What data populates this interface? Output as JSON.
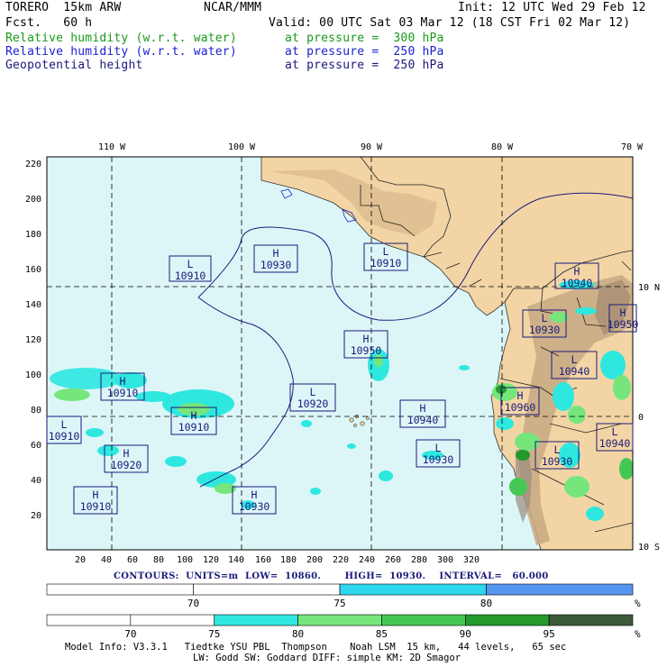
{
  "header": {
    "model": "TORERO  15km ARW",
    "center": "NCAR/MMM",
    "init": "Init: 12 UTC Wed 29 Feb 12",
    "fcst": "Fcst.   60 h",
    "valid": "Valid: 00 UTC Sat 03 Mar 12 (18 CST Fri 02 Mar 12)",
    "fields": [
      {
        "name": "Relative humidity (w.r.t. water)",
        "level": "at pressure =  300 hPa",
        "color": "#1a9a1a"
      },
      {
        "name": "Relative humidity (w.r.t. water)",
        "level": "at pressure =  250 hPa",
        "color": "#1a22cc"
      },
      {
        "name": "Geopotential height",
        "level": "at pressure =  250 hPa",
        "color": "#1a1a7a"
      }
    ]
  },
  "map": {
    "top_lon_labels": [
      "110 W",
      "100 W",
      "90 W",
      "80 W",
      "70 W"
    ],
    "right_lat_labels": [
      "10 N",
      "0",
      "10 S"
    ],
    "y_ticks": [
      "220",
      "200",
      "180",
      "160",
      "140",
      "120",
      "100",
      "80",
      "60",
      "40",
      "20"
    ],
    "x_ticks": [
      "20",
      "40",
      "60",
      "80",
      "100",
      "120",
      "140",
      "160",
      "180",
      "200",
      "220",
      "240",
      "260",
      "280",
      "300",
      "320"
    ],
    "highs_lows": [
      {
        "kind": "L",
        "value": "10910"
      },
      {
        "kind": "H",
        "value": "10930"
      },
      {
        "kind": "L",
        "value": "10910"
      },
      {
        "kind": "H",
        "value": "10940"
      },
      {
        "kind": "L",
        "value": "10930"
      },
      {
        "kind": "H",
        "value": "10950"
      },
      {
        "kind": "H",
        "value": "10950"
      },
      {
        "kind": "L",
        "value": "10940"
      },
      {
        "kind": "H",
        "value": "10910"
      },
      {
        "kind": "L",
        "value": "10920"
      },
      {
        "kind": "H",
        "value": "10960"
      },
      {
        "kind": "H",
        "value": "10910"
      },
      {
        "kind": "H",
        "value": "10940"
      },
      {
        "kind": "L",
        "value": "10910"
      },
      {
        "kind": "L",
        "value": "10940"
      },
      {
        "kind": "H",
        "value": "10920"
      },
      {
        "kind": "L",
        "value": "10930"
      },
      {
        "kind": "L",
        "value": "10930"
      },
      {
        "kind": "H",
        "value": "10910"
      },
      {
        "kind": "H",
        "value": "10930"
      }
    ]
  },
  "contours": {
    "text": "CONTOURS:  UNITS=m  LOW=  10860.       HIGH=  10930.    INTERVAL=   60.000"
  },
  "colorbar_300": {
    "ticks": [
      "70",
      "75",
      "80"
    ],
    "unit": "%",
    "colors": [
      "#ffffff",
      "#ffffff",
      "#2ed6ee",
      "#5596f0"
    ]
  },
  "colorbar_250": {
    "ticks": [
      "70",
      "75",
      "80",
      "85",
      "90",
      "95"
    ],
    "unit": "%",
    "colors": [
      "#ffffff",
      "#ffffff",
      "#2ee8e0",
      "#76e67c",
      "#45c853",
      "#239a2b",
      "#3a5a3a"
    ]
  },
  "footer": {
    "line1": "Model Info: V3.3.1   Tiedtke YSU PBL  Thompson    Noah LSM  15 km,   44 levels,   65 sec",
    "line2": "LW: Godd SW: Goddard DIFF: simple KM: 2D Smagor"
  }
}
